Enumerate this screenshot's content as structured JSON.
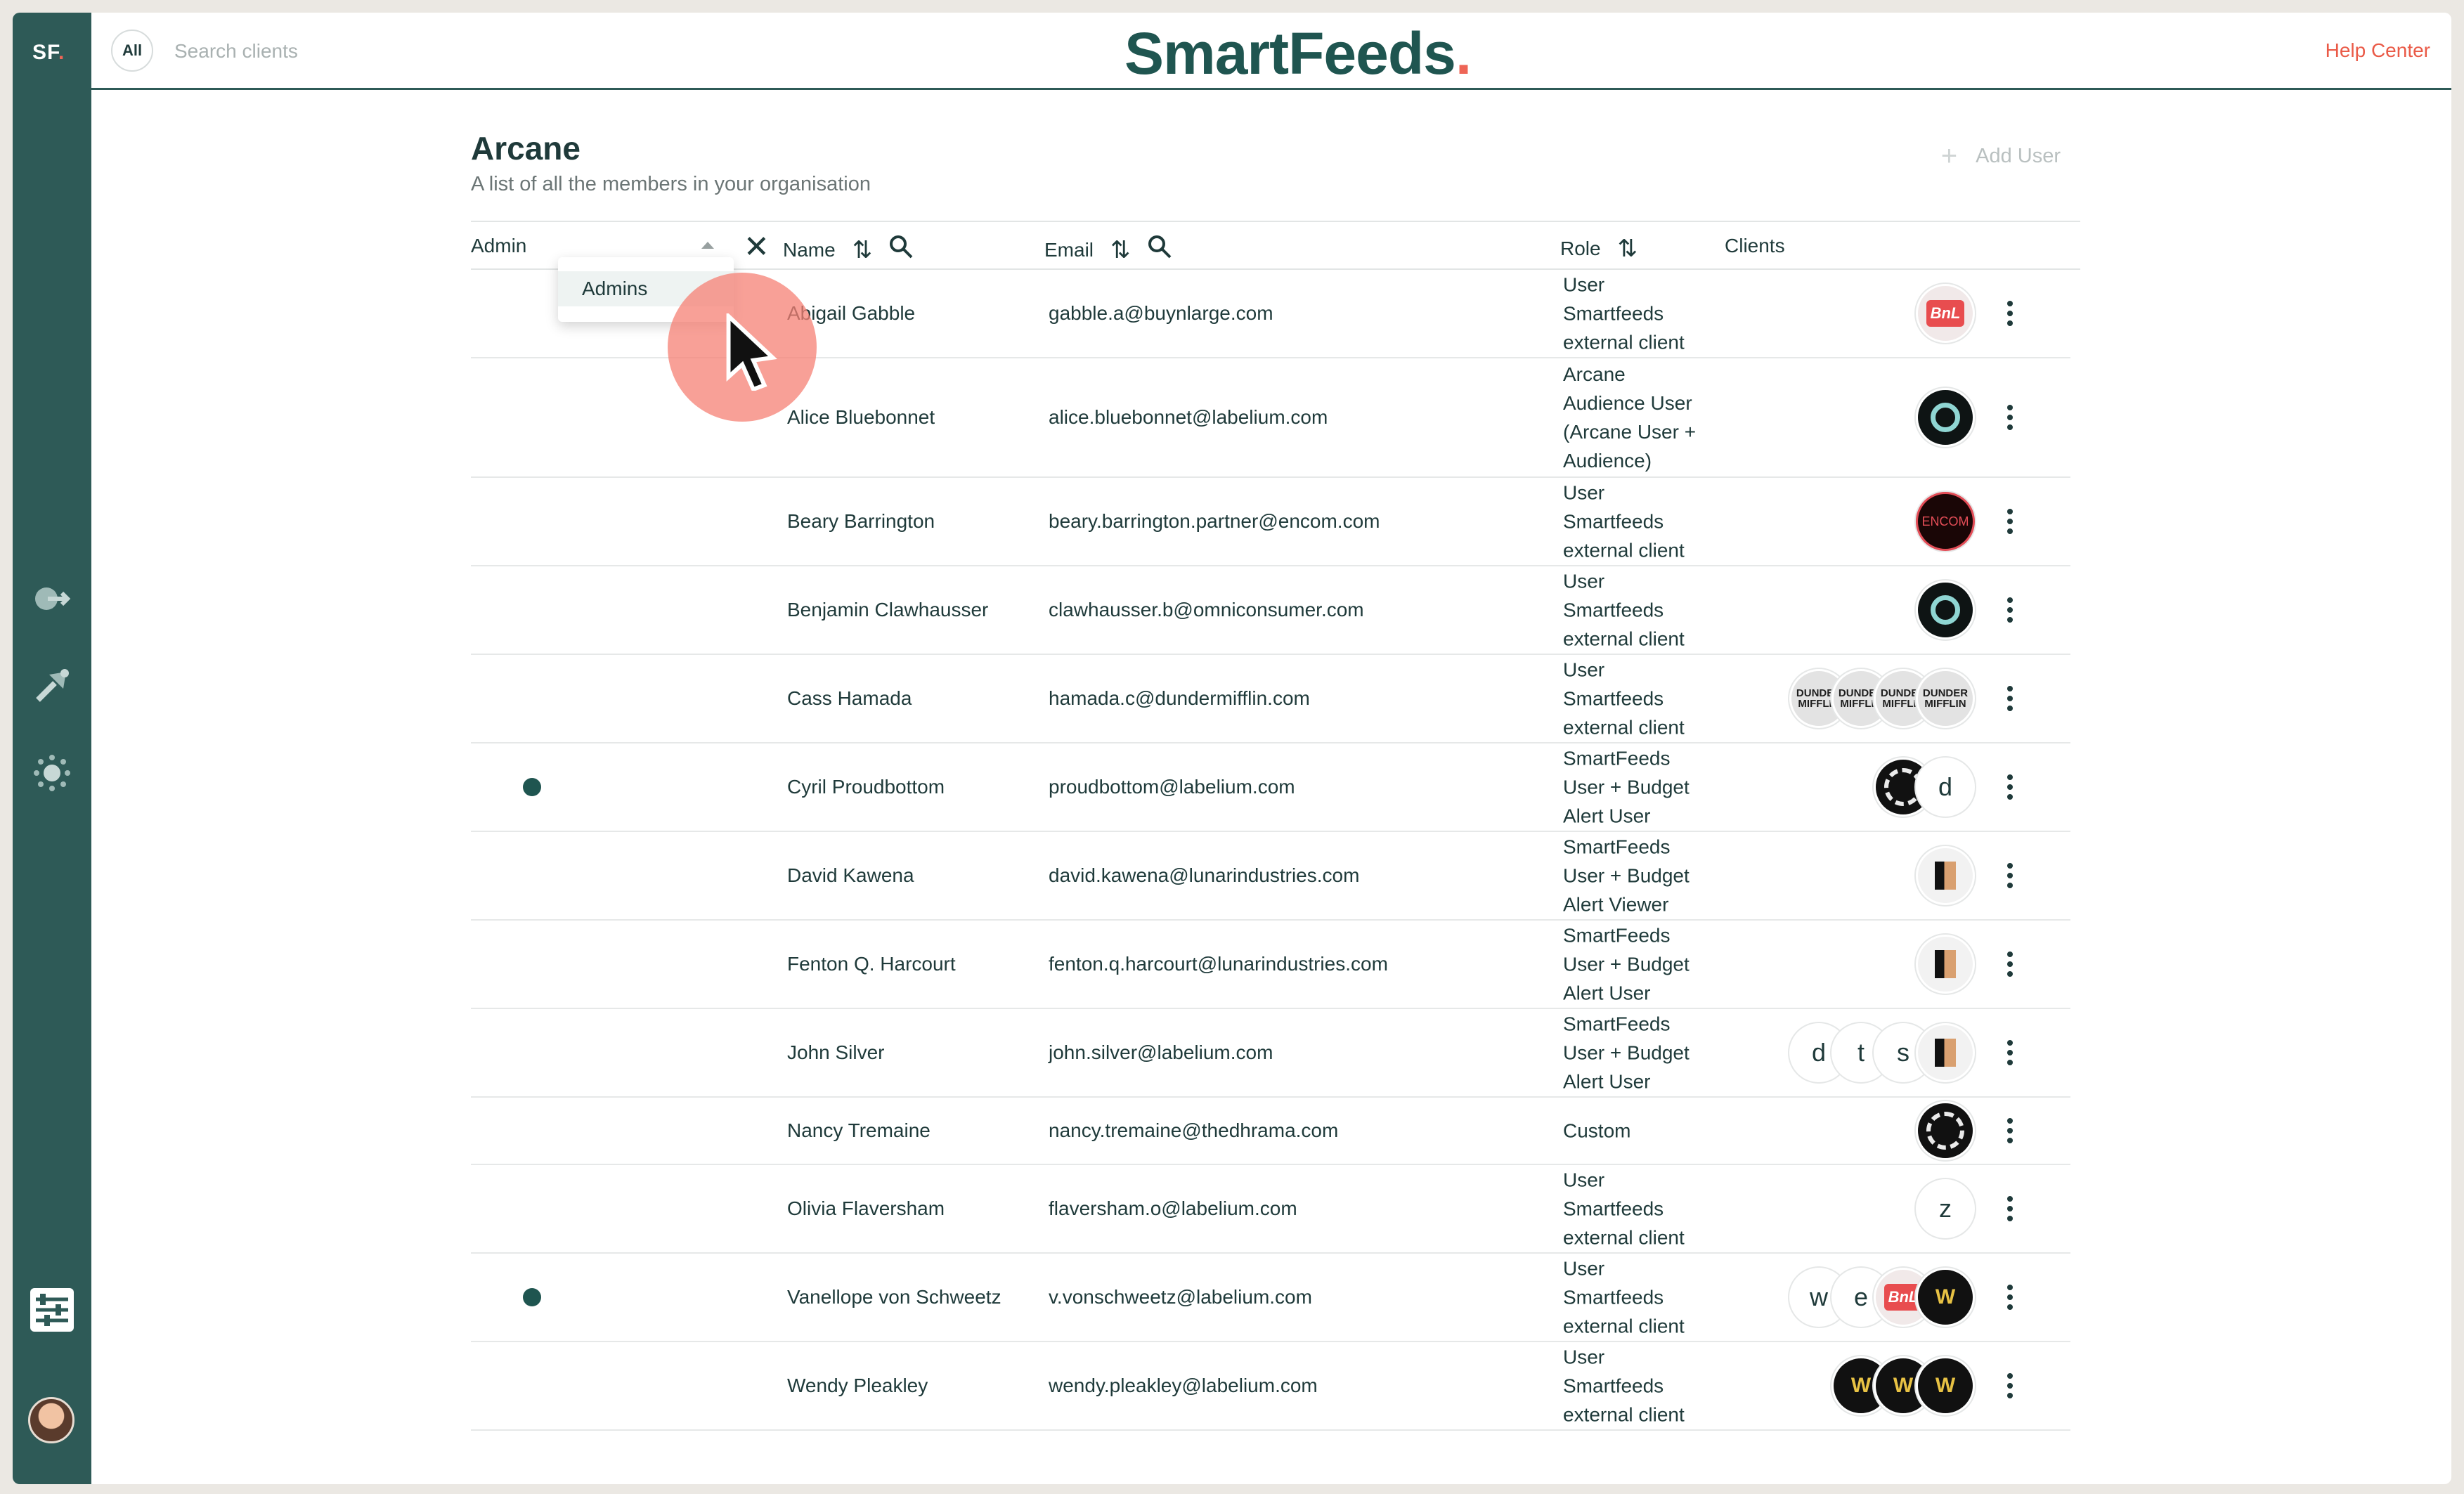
{
  "app": {
    "logo_text": "SF",
    "logo_dot": ".",
    "brand": "SmartFeeds",
    "brand_dot": ".",
    "help_label": "Help Center",
    "colors": {
      "primary": "#2e5a57",
      "accent": "#ee6556",
      "link": "#ea5a47"
    }
  },
  "search": {
    "all_label": "All",
    "placeholder": "Search clients"
  },
  "sidebar": {
    "icons": [
      "exit-icon",
      "paper-plane-icon",
      "settings-gear-icon",
      "adjustments-icon"
    ]
  },
  "page": {
    "title": "Arcane",
    "subtitle": "A list of all the members in your organisation",
    "add_user_icon": "+",
    "add_user_label": "Add User"
  },
  "table": {
    "headers": {
      "admin": "Admin",
      "name": "Name",
      "email": "Email",
      "role": "Role",
      "clients": "Clients"
    },
    "filter_option": "Admins",
    "rows": [
      {
        "admin": false,
        "name": "Abigail Gabble",
        "email": "gabble.a@buynlarge.com",
        "role": "User\nSmartfeeds\nexternal client",
        "clients": [
          "bnl"
        ]
      },
      {
        "admin": false,
        "name": "Alice Bluebonnet",
        "email": "alice.bluebonnet@labelium.com",
        "role": "Arcane\nAudience User\n(Arcane User +\nAudience)",
        "clients": [
          "octo"
        ]
      },
      {
        "admin": false,
        "name": "Beary Barrington",
        "email": "beary.barrington.partner@encom.com",
        "role": "User\nSmartfeeds\nexternal client",
        "clients": [
          "encom"
        ]
      },
      {
        "admin": false,
        "name": "Benjamin Clawhausser",
        "email": "clawhausser.b@omniconsumer.com",
        "role": "User\nSmartfeeds\nexternal client",
        "clients": [
          "octo"
        ]
      },
      {
        "admin": false,
        "name": "Cass Hamada",
        "email": "hamada.c@dundermifflin.com",
        "role": "User\nSmartfeeds\nexternal client",
        "clients": [
          "dunder",
          "dunder",
          "dunder",
          "dunder"
        ]
      },
      {
        "admin": true,
        "name": "Cyril Proudbottom",
        "email": "proudbottom@labelium.com",
        "role": "SmartFeeds\nUser + Budget\nAlert User",
        "clients": [
          "dharma",
          "d"
        ]
      },
      {
        "admin": false,
        "name": "David Kawena",
        "email": "david.kawena@lunarindustries.com",
        "role": "SmartFeeds\nUser + Budget\nAlert Viewer",
        "clients": [
          "lunar"
        ]
      },
      {
        "admin": false,
        "name": "Fenton Q. Harcourt",
        "email": "fenton.q.harcourt@lunarindustries.com",
        "role": "SmartFeeds\nUser + Budget\nAlert User",
        "clients": [
          "lunar"
        ]
      },
      {
        "admin": false,
        "name": "John Silver",
        "email": "john.silver@labelium.com",
        "role": "SmartFeeds\nUser + Budget\nAlert User",
        "clients": [
          "d",
          "t",
          "s",
          "lunar"
        ]
      },
      {
        "admin": false,
        "name": "Nancy Tremaine",
        "email": "nancy.tremaine@thedhrama.com",
        "role": "Custom",
        "clients": [
          "dharma"
        ]
      },
      {
        "admin": false,
        "name": "Olivia Flaversham",
        "email": "flaversham.o@labelium.com",
        "role": "User\nSmartfeeds\nexternal client",
        "clients": [
          "z"
        ]
      },
      {
        "admin": true,
        "name": "Vanellope von Schweetz",
        "email": "v.vonschweetz@labelium.com",
        "role": "User\nSmartfeeds\nexternal client",
        "clients": [
          "w",
          "e",
          "bnl",
          "wy"
        ]
      },
      {
        "admin": false,
        "name": "Wendy Pleakley",
        "email": "wendy.pleakley@labelium.com",
        "role": "User\nSmartfeeds\nexternal client",
        "clients": [
          "wy",
          "wy",
          "wy"
        ]
      }
    ]
  },
  "client_logos": {
    "bnl": "BnL",
    "encom": "ENCOM",
    "dunder": "DUNDER\nMIFFLIN",
    "wy": "W"
  }
}
